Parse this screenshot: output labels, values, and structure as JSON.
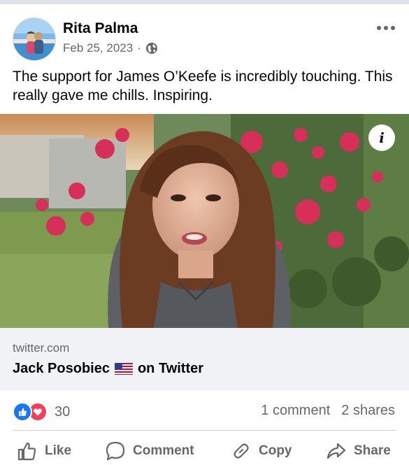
{
  "post": {
    "author": "Rita Palma",
    "date": "Feb 25, 2023",
    "separator": "·",
    "privacy_icon": "globe-icon",
    "text": "The support for James O’Keefe is incredibly touching. This really gave me chills. Inspiring."
  },
  "video": {
    "info_label": "i"
  },
  "link": {
    "domain": "twitter.com",
    "title_name": "Jack Posobiec",
    "title_suffix": "on Twitter"
  },
  "reactions": {
    "count": "30",
    "icons": [
      "like-icon",
      "love-icon"
    ],
    "comments": "1 comment",
    "shares": "2 shares"
  },
  "actions": {
    "like": "Like",
    "comment": "Comment",
    "copy": "Copy",
    "share": "Share"
  },
  "colors": {
    "like_blue": "#1877f2",
    "love_red": "#f33e58",
    "secondary_text": "#65676b",
    "link_bg": "#f0f2f5"
  }
}
